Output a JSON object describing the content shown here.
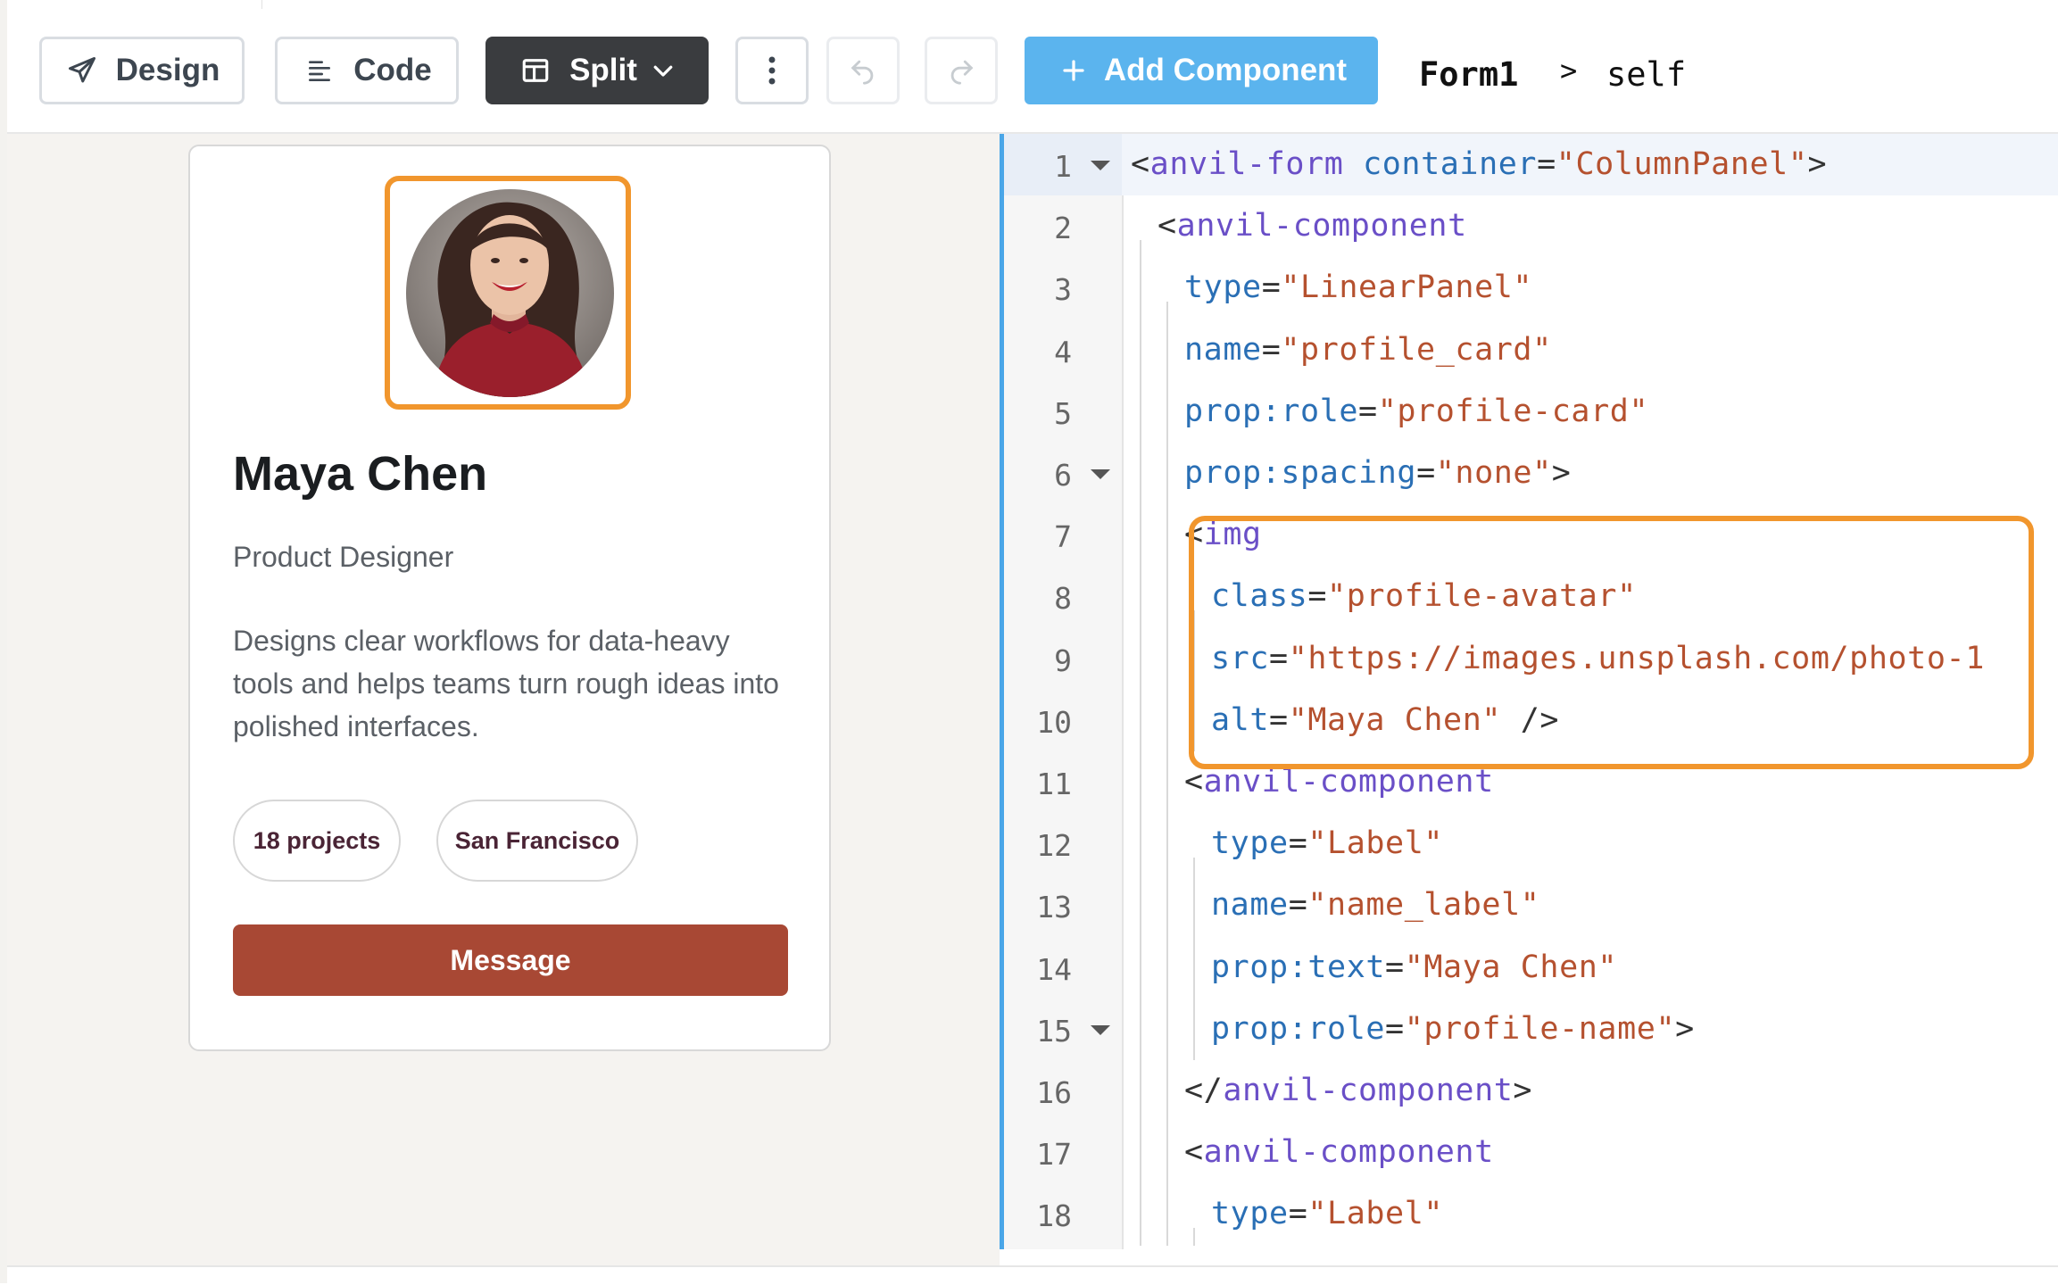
{
  "toolbar": {
    "design_label": "Design",
    "code_label": "Code",
    "split_label": "Split",
    "add_component_label": "Add Component",
    "form_name": "Form1",
    "breadcrumb_separator": ">",
    "context": "self"
  },
  "profile": {
    "name": "Maya Chen",
    "role": "Product Designer",
    "bio": "Designs clear workflows for data-heavy tools and helps teams turn rough ideas into polished interfaces.",
    "chips": [
      "18 projects",
      "San Francisco"
    ],
    "message_label": "Message",
    "avatar_alt": "Maya Chen"
  },
  "code": {
    "lines": [
      {
        "num": "1",
        "fold": true,
        "tokens": [
          {
            "t": "<",
            "c": "#333333"
          },
          {
            "t": "anvil-form",
            "c": "#6a4fc7"
          },
          {
            "t": " ",
            "c": "#333333"
          },
          {
            "t": "container",
            "c": "#2a6fb5"
          },
          {
            "t": "=",
            "c": "#333333"
          },
          {
            "t": "\"ColumnPanel\"",
            "c": "#b5512f"
          },
          {
            "t": ">",
            "c": "#333333"
          }
        ]
      },
      {
        "num": "2",
        "fold": false,
        "tokens": [
          {
            "t": "<",
            "c": "#333333"
          },
          {
            "t": "anvil-component",
            "c": "#6a4fc7"
          }
        ]
      },
      {
        "num": "3",
        "fold": false,
        "tokens": [
          {
            "t": "type",
            "c": "#2a6fb5"
          },
          {
            "t": "=",
            "c": "#333333"
          },
          {
            "t": "\"LinearPanel\"",
            "c": "#b5512f"
          }
        ]
      },
      {
        "num": "4",
        "fold": false,
        "tokens": [
          {
            "t": "name",
            "c": "#2a6fb5"
          },
          {
            "t": "=",
            "c": "#333333"
          },
          {
            "t": "\"profile_card\"",
            "c": "#b5512f"
          }
        ]
      },
      {
        "num": "5",
        "fold": false,
        "tokens": [
          {
            "t": "prop:role",
            "c": "#2a6fb5"
          },
          {
            "t": "=",
            "c": "#333333"
          },
          {
            "t": "\"profile-card\"",
            "c": "#b5512f"
          }
        ]
      },
      {
        "num": "6",
        "fold": true,
        "tokens": [
          {
            "t": "prop:spacing",
            "c": "#2a6fb5"
          },
          {
            "t": "=",
            "c": "#333333"
          },
          {
            "t": "\"none\"",
            "c": "#b5512f"
          },
          {
            "t": ">",
            "c": "#333333"
          }
        ]
      },
      {
        "num": "7",
        "fold": false,
        "tokens": [
          {
            "t": "<",
            "c": "#333333"
          },
          {
            "t": "img",
            "c": "#6a4fc7"
          }
        ]
      },
      {
        "num": "8",
        "fold": false,
        "tokens": [
          {
            "t": "class",
            "c": "#2a6fb5"
          },
          {
            "t": "=",
            "c": "#333333"
          },
          {
            "t": "\"profile-avatar\"",
            "c": "#b5512f"
          }
        ]
      },
      {
        "num": "9",
        "fold": false,
        "tokens": [
          {
            "t": "src",
            "c": "#2a6fb5"
          },
          {
            "t": "=",
            "c": "#333333"
          },
          {
            "t": "\"https://images.unsplash.com/photo-1",
            "c": "#b5512f"
          }
        ]
      },
      {
        "num": "10",
        "fold": false,
        "tokens": [
          {
            "t": "alt",
            "c": "#2a6fb5"
          },
          {
            "t": "=",
            "c": "#333333"
          },
          {
            "t": "\"Maya Chen\"",
            "c": "#b5512f"
          },
          {
            "t": " />",
            "c": "#333333"
          }
        ]
      },
      {
        "num": "11",
        "fold": false,
        "tokens": [
          {
            "t": "<",
            "c": "#333333"
          },
          {
            "t": "anvil-component",
            "c": "#6a4fc7"
          }
        ]
      },
      {
        "num": "12",
        "fold": false,
        "tokens": [
          {
            "t": "type",
            "c": "#2a6fb5"
          },
          {
            "t": "=",
            "c": "#333333"
          },
          {
            "t": "\"Label\"",
            "c": "#b5512f"
          }
        ]
      },
      {
        "num": "13",
        "fold": false,
        "tokens": [
          {
            "t": "name",
            "c": "#2a6fb5"
          },
          {
            "t": "=",
            "c": "#333333"
          },
          {
            "t": "\"name_label\"",
            "c": "#b5512f"
          }
        ]
      },
      {
        "num": "14",
        "fold": false,
        "tokens": [
          {
            "t": "prop:text",
            "c": "#2a6fb5"
          },
          {
            "t": "=",
            "c": "#333333"
          },
          {
            "t": "\"Maya Chen\"",
            "c": "#b5512f"
          }
        ]
      },
      {
        "num": "15",
        "fold": true,
        "tokens": [
          {
            "t": "prop:role",
            "c": "#2a6fb5"
          },
          {
            "t": "=",
            "c": "#333333"
          },
          {
            "t": "\"profile-name\"",
            "c": "#b5512f"
          },
          {
            "t": ">",
            "c": "#333333"
          }
        ]
      },
      {
        "num": "16",
        "fold": false,
        "tokens": [
          {
            "t": "</",
            "c": "#333333"
          },
          {
            "t": "anvil-component",
            "c": "#6a4fc7"
          },
          {
            "t": ">",
            "c": "#333333"
          }
        ]
      },
      {
        "num": "17",
        "fold": false,
        "tokens": [
          {
            "t": "<",
            "c": "#333333"
          },
          {
            "t": "anvil-component",
            "c": "#6a4fc7"
          }
        ]
      },
      {
        "num": "18",
        "fold": false,
        "tokens": [
          {
            "t": "type",
            "c": "#2a6fb5"
          },
          {
            "t": "=",
            "c": "#333333"
          },
          {
            "t": "\"Label\"",
            "c": "#b5512f"
          }
        ]
      }
    ]
  },
  "colors": {
    "highlight_outline": "#f1962d",
    "primary_button": "#5bb4ee",
    "message_button": "#a84834",
    "splitter": "#4aa6e8"
  }
}
